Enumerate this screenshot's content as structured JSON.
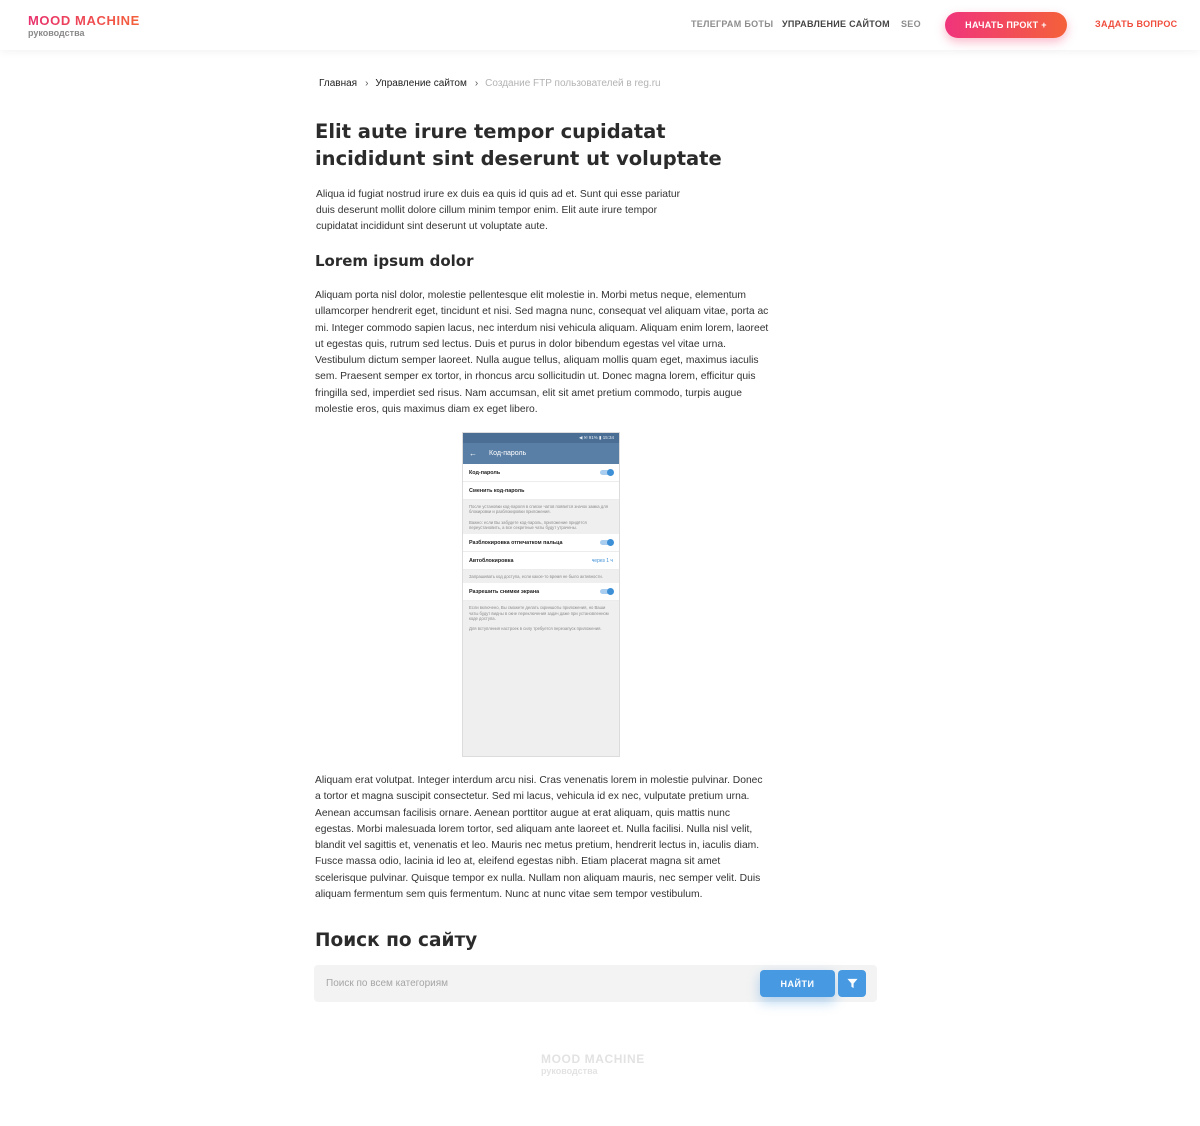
{
  "header": {
    "logo_title": "MOOD MACHINE",
    "logo_subtitle": "руководства",
    "nav": [
      "ТЕЛЕГРАМ БОТЫ",
      "УПРАВЛЕНИЕ САЙТОМ",
      "SEO"
    ],
    "cta_label": "НАЧАТЬ ПРОКТ +",
    "ask_label": "ЗАДАТЬ ВОПРОС",
    "accent_gradient": [
      "#f0347c",
      "#f4613a"
    ]
  },
  "breadcrumb": {
    "home": "Главная",
    "section": "Управление сайтом",
    "current": "Создание FTP пользователей в reg.ru"
  },
  "article": {
    "title": "Elit aute irure tempor cupidatat incididunt sint deserunt ut voluptate",
    "intro": "Aliqua id fugiat nostrud irure ex duis ea quis id quis ad et. Sunt qui esse pariatur duis deserunt mollit dolore cillum minim tempor enim. Elit aute irure tempor cupidatat incididunt sint deserunt ut voluptate aute.",
    "subheading": "Lorem ipsum dolor",
    "paragraph1": "Aliquam porta nisl dolor, molestie pellentesque elit molestie in. Morbi metus neque, elementum ullamcorper hendrerit eget, tincidunt et nisi. Sed magna nunc, consequat vel aliquam vitae, porta ac mi. Integer commodo sapien lacus, nec interdum nisi vehicula aliquam. Aliquam enim lorem, laoreet ut egestas quis, rutrum sed lectus. Duis et purus in dolor bibendum egestas vel vitae urna. Vestibulum dictum semper laoreet. Nulla augue tellus, aliquam mollis quam eget, maximus iaculis sem. Praesent semper ex tortor, in rhoncus arcu sollicitudin ut. Donec magna lorem, efficitur quis fringilla sed, imperdiet sed risus. Nam accumsan, elit sit amet pretium commodo, turpis augue molestie eros, quis maximus diam ex eget libero.",
    "paragraph2": " Aliquam erat volutpat. Integer interdum arcu nisi. Cras venenatis lorem in molestie pulvinar. Donec a tortor et magna suscipit consectetur. Sed mi lacus, vehicula id ex nec, vulputate pretium urna. Aenean accumsan facilisis ornare. Aenean porttitor augue at erat aliquam, quis mattis nunc egestas. Morbi malesuada lorem tortor, sed aliquam ante laoreet et. Nulla facilisi. Nulla nisl velit, blandit vel sagittis et, venenatis et leo. Mauris nec metus pretium, hendrerit lectus in, iaculis diam. Fusce massa odio, lacinia id leo at, eleifend egestas nibh. Etiam placerat magna sit amet scelerisque pulvinar. Quisque tempor ex nulla. Nullam non aliquam mauris, nec semper velit. Duis aliquam fermentum sem quis fermentum. Nunc at nunc vitae sem tempor vestibulum."
  },
  "phone": {
    "status": "◀ ✉ 91% ▮ 15:34",
    "screen_title": "Код-пароль",
    "row_passcode": "Код-пароль",
    "row_change": "Сменить код-пароль",
    "note1": "После установки код-пароля в списке чатов появится значок замка для блокировки и разблокировки приложения.",
    "note2": "Важно: если Вы забудете код-пароль, приложение придётся переустановить, а все секретные чаты будут утрачены.",
    "row_fingerprint": "Разблокировка отпечатком пальца",
    "row_autolock": "Автоблокировка",
    "autolock_value": "через 1 ч",
    "note3": "Запрашивать код доступа, если какое-то время не было активности.",
    "row_screenshots": "Разрешить снимки экрана",
    "note4": "Если включено, Вы сможете делать скриншоты приложения, но Ваши чаты будут видны в окне переключения задач даже при установленном коде доступа.",
    "note5": "Для вступления настроек в силу требуется перезапуск приложения."
  },
  "search": {
    "title": "Поиск по сайту",
    "placeholder": "Поиск по всем категориям",
    "button_label": "НАЙТИ",
    "filter_icon": "filter-icon"
  },
  "footer": {
    "logo_title": "MOOD MACHINE",
    "logo_subtitle": "руководства"
  }
}
